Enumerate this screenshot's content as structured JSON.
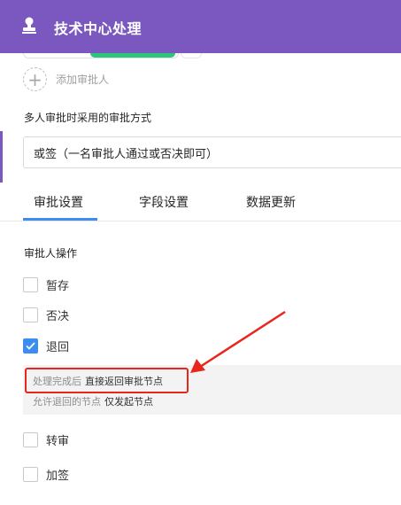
{
  "header": {
    "icon": "user-stamp-icon",
    "title": "技术中心处理",
    "color": "#7a58bf"
  },
  "approvers": {
    "add_label": "添加审批人",
    "add_icon": "plus-icon"
  },
  "mode": {
    "label": "多人审批时采用的审批方式",
    "selected": "或签（一名审批人通过或否决即可）"
  },
  "tabs": [
    {
      "label": "审批设置",
      "active": true
    },
    {
      "label": "字段设置",
      "active": false
    },
    {
      "label": "数据更新",
      "active": false
    }
  ],
  "operations": {
    "label": "审批人操作",
    "items": [
      {
        "label": "暂存",
        "checked": false
      },
      {
        "label": "否决",
        "checked": false
      },
      {
        "label": "退回",
        "checked": true
      },
      {
        "label": "转审",
        "checked": false
      },
      {
        "label": "加签",
        "checked": false
      }
    ],
    "return_info": {
      "after_key": "处理完成后",
      "after_value": "直接返回审批节点",
      "nodes_key": "允许退回的节点",
      "nodes_value": "仅发起节点"
    }
  },
  "colors": {
    "accent_blue": "#3b8df0",
    "annotation_red": "#e8261c",
    "green": "#2bc57b"
  }
}
